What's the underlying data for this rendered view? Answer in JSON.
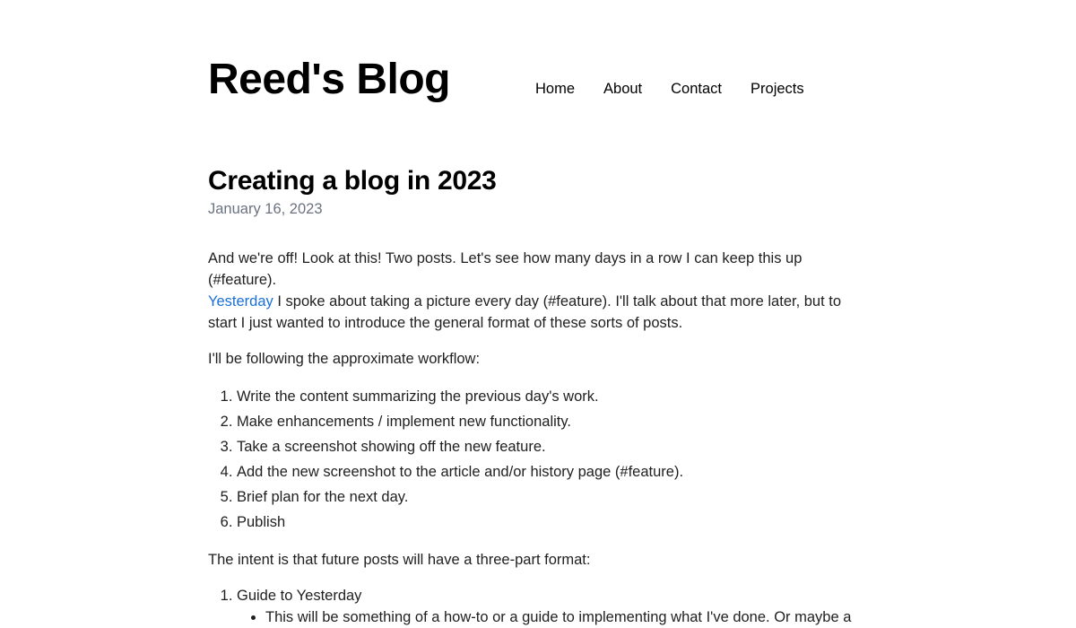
{
  "site": {
    "title": "Reed's Blog"
  },
  "nav": {
    "items": [
      "Home",
      "About",
      "Contact",
      "Projects"
    ]
  },
  "post": {
    "title": "Creating a blog in 2023",
    "date": "January 16, 2023",
    "intro_line1": "And we're off! Look at this! Two posts. Let's see how many days in a row I can keep this up (#feature).",
    "intro_link": "Yesterday",
    "intro_rest": " I spoke about taking a picture every day (#feature). I'll talk about that more later, but to start I just wanted to introduce the general format of these sorts of posts.",
    "workflow_intro": "I'll be following the approximate workflow:",
    "workflow_steps": [
      "Write the content summarizing the previous day's work.",
      "Make enhancements / implement new functionality.",
      "Take a screenshot showing off the new feature.",
      "Add the new screenshot to the article and/or history page (#feature).",
      "Brief plan for the next day.",
      "Publish"
    ],
    "format_intro": "The intent is that future posts will have a three-part format:",
    "format_parts": [
      {
        "label": "Guide to Yesterday",
        "sub": [
          "This will be something of a how-to or a guide to implementing what I've done. Or maybe a"
        ]
      }
    ]
  },
  "colors": {
    "link": "#1a6fd6",
    "date": "#6b7280",
    "text": "#1f1f1f"
  }
}
